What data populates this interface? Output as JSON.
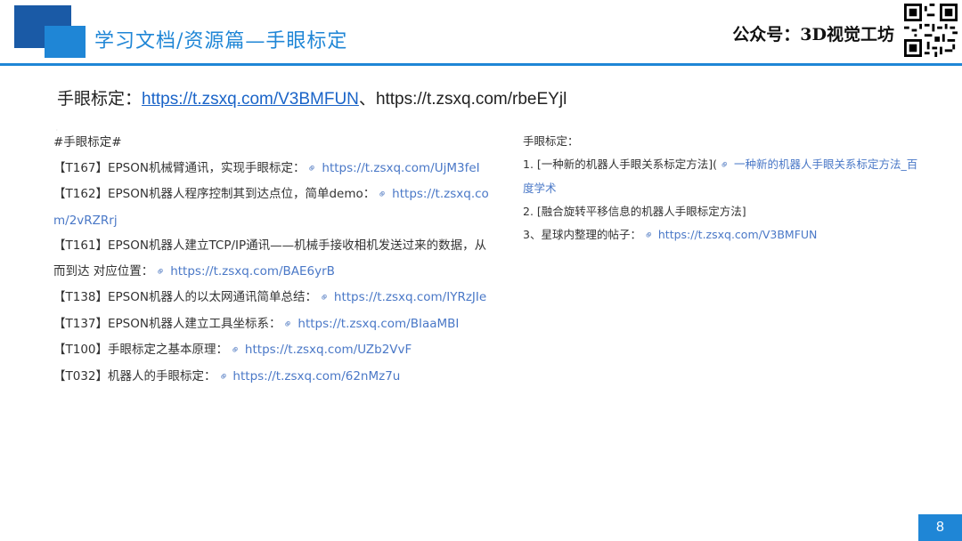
{
  "header": {
    "title": "学习文档/资源篇—手眼标定",
    "brand": "公众号：3D视觉工坊"
  },
  "main_line": {
    "label": "手眼标定：",
    "link1": "https://t.zsxq.com/V3BMFUN",
    "separator": "、",
    "link2": "https://t.zsxq.com/rbeEYjl"
  },
  "left_column": {
    "heading": "#手眼标定#",
    "items": [
      {
        "text": "【T167】EPSON机械臂通讯，实现手眼标定：",
        "link": "https://t.zsxq.com/UjM3feI"
      },
      {
        "text": "【T162】EPSON机器人程序控制其到达点位，简单demo：",
        "link": "https://t.zsxq.co",
        "link_cont": "m/2vRZRrj"
      },
      {
        "text": "【T161】EPSON机器人建立TCP/IP通讯——机械手接收相机发送过来的数据，从",
        "text_cont": "而到达 对应位置：",
        "link": "https://t.zsxq.com/BAE6yrB"
      },
      {
        "text": "【T138】EPSON机器人的以太网通讯简单总结：",
        "link": "https://t.zsxq.com/IYRzJIe"
      },
      {
        "text": "【T137】EPSON机器人建立工具坐标系：",
        "link": "https://t.zsxq.com/BIaaMBI"
      },
      {
        "text": "【T100】手眼标定之基本原理：",
        "link": "https://t.zsxq.com/UZb2VvF"
      },
      {
        "text": "【T032】机器人的手眼标定：",
        "link": "https://t.zsxq.com/62nMz7u"
      }
    ]
  },
  "right_column": {
    "heading": "手眼标定：",
    "item1_prefix": "1. [一种新的机器人手眼关系标定方法](",
    "item1_link": "一种新的机器人手眼关系标定方法_百",
    "item1_link_cont": "度学术",
    "item2": "2. [融合旋转平移信息的机器人手眼标定方法]",
    "item3_prefix": "3、星球内整理的帖子：",
    "item3_link": "https://t.zsxq.com/V3BMFUN"
  },
  "page_number": "8",
  "icons": {
    "link": "link-icon",
    "qr": "qr-code-icon"
  },
  "colors": {
    "accent": "#1f86d6",
    "dark_accent": "#1a5aa6",
    "link": "#4a78c7"
  }
}
